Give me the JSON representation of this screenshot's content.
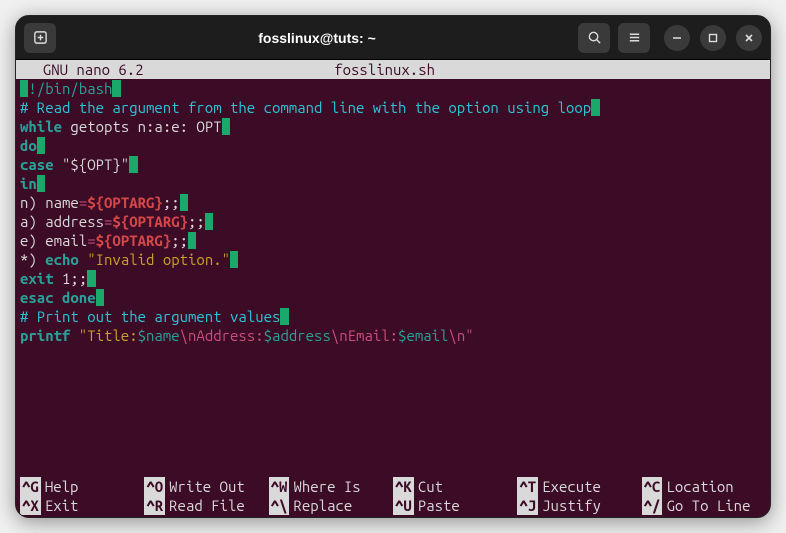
{
  "titlebar": {
    "title": "fosslinux@tuts: ~"
  },
  "nano": {
    "app": "  GNU nano 6.2",
    "filename": "fosslinux.sh"
  },
  "code": {
    "shebang_h": "#",
    "shebang_rest": "!/bin/bash",
    "comment1": "# Read the argument from the command line with the option using loop",
    "while_kw": "while",
    "while_rest": " getopts n:a:e: OPT",
    "do_kw": "do",
    "case_kw": "case",
    "case_var": " \"${OPT}\"",
    "in_kw": "in",
    "n_label": "n",
    "n_paren": ") name",
    "eq": "=",
    "optarg": "${OPTARG}",
    "dsemi": ";;",
    "a_label": "a",
    "a_paren": ") address",
    "e_label": "e",
    "e_paren": ") email",
    "star_label": "*",
    "star_paren": ") ",
    "echo_kw": "echo",
    "invalid": " \"Invalid option.\"",
    "exit_kw": "exit",
    "exit_rest": " 1",
    "esac_kw": "esac",
    "done_kw": " done",
    "comment2": "# Print out the argument values",
    "printf_kw": "printf",
    "printf_str": " \"Title:",
    "var_name": "$name",
    "nl1": "\\nAddress:",
    "var_addr": "$address",
    "nl2": "\\nEmail:",
    "var_email": "$email",
    "nl3": "\\n\""
  },
  "shortcuts": [
    {
      "key": "^G",
      "label": "Help"
    },
    {
      "key": "^X",
      "label": "Exit"
    },
    {
      "key": "^O",
      "label": "Write Out"
    },
    {
      "key": "^R",
      "label": "Read File"
    },
    {
      "key": "^W",
      "label": "Where Is"
    },
    {
      "key": "^\\",
      "label": "Replace"
    },
    {
      "key": "^K",
      "label": "Cut"
    },
    {
      "key": "^U",
      "label": "Paste"
    },
    {
      "key": "^T",
      "label": "Execute"
    },
    {
      "key": "^J",
      "label": "Justify"
    },
    {
      "key": "^C",
      "label": "Location"
    },
    {
      "key": "^/",
      "label": "Go To Line"
    }
  ]
}
